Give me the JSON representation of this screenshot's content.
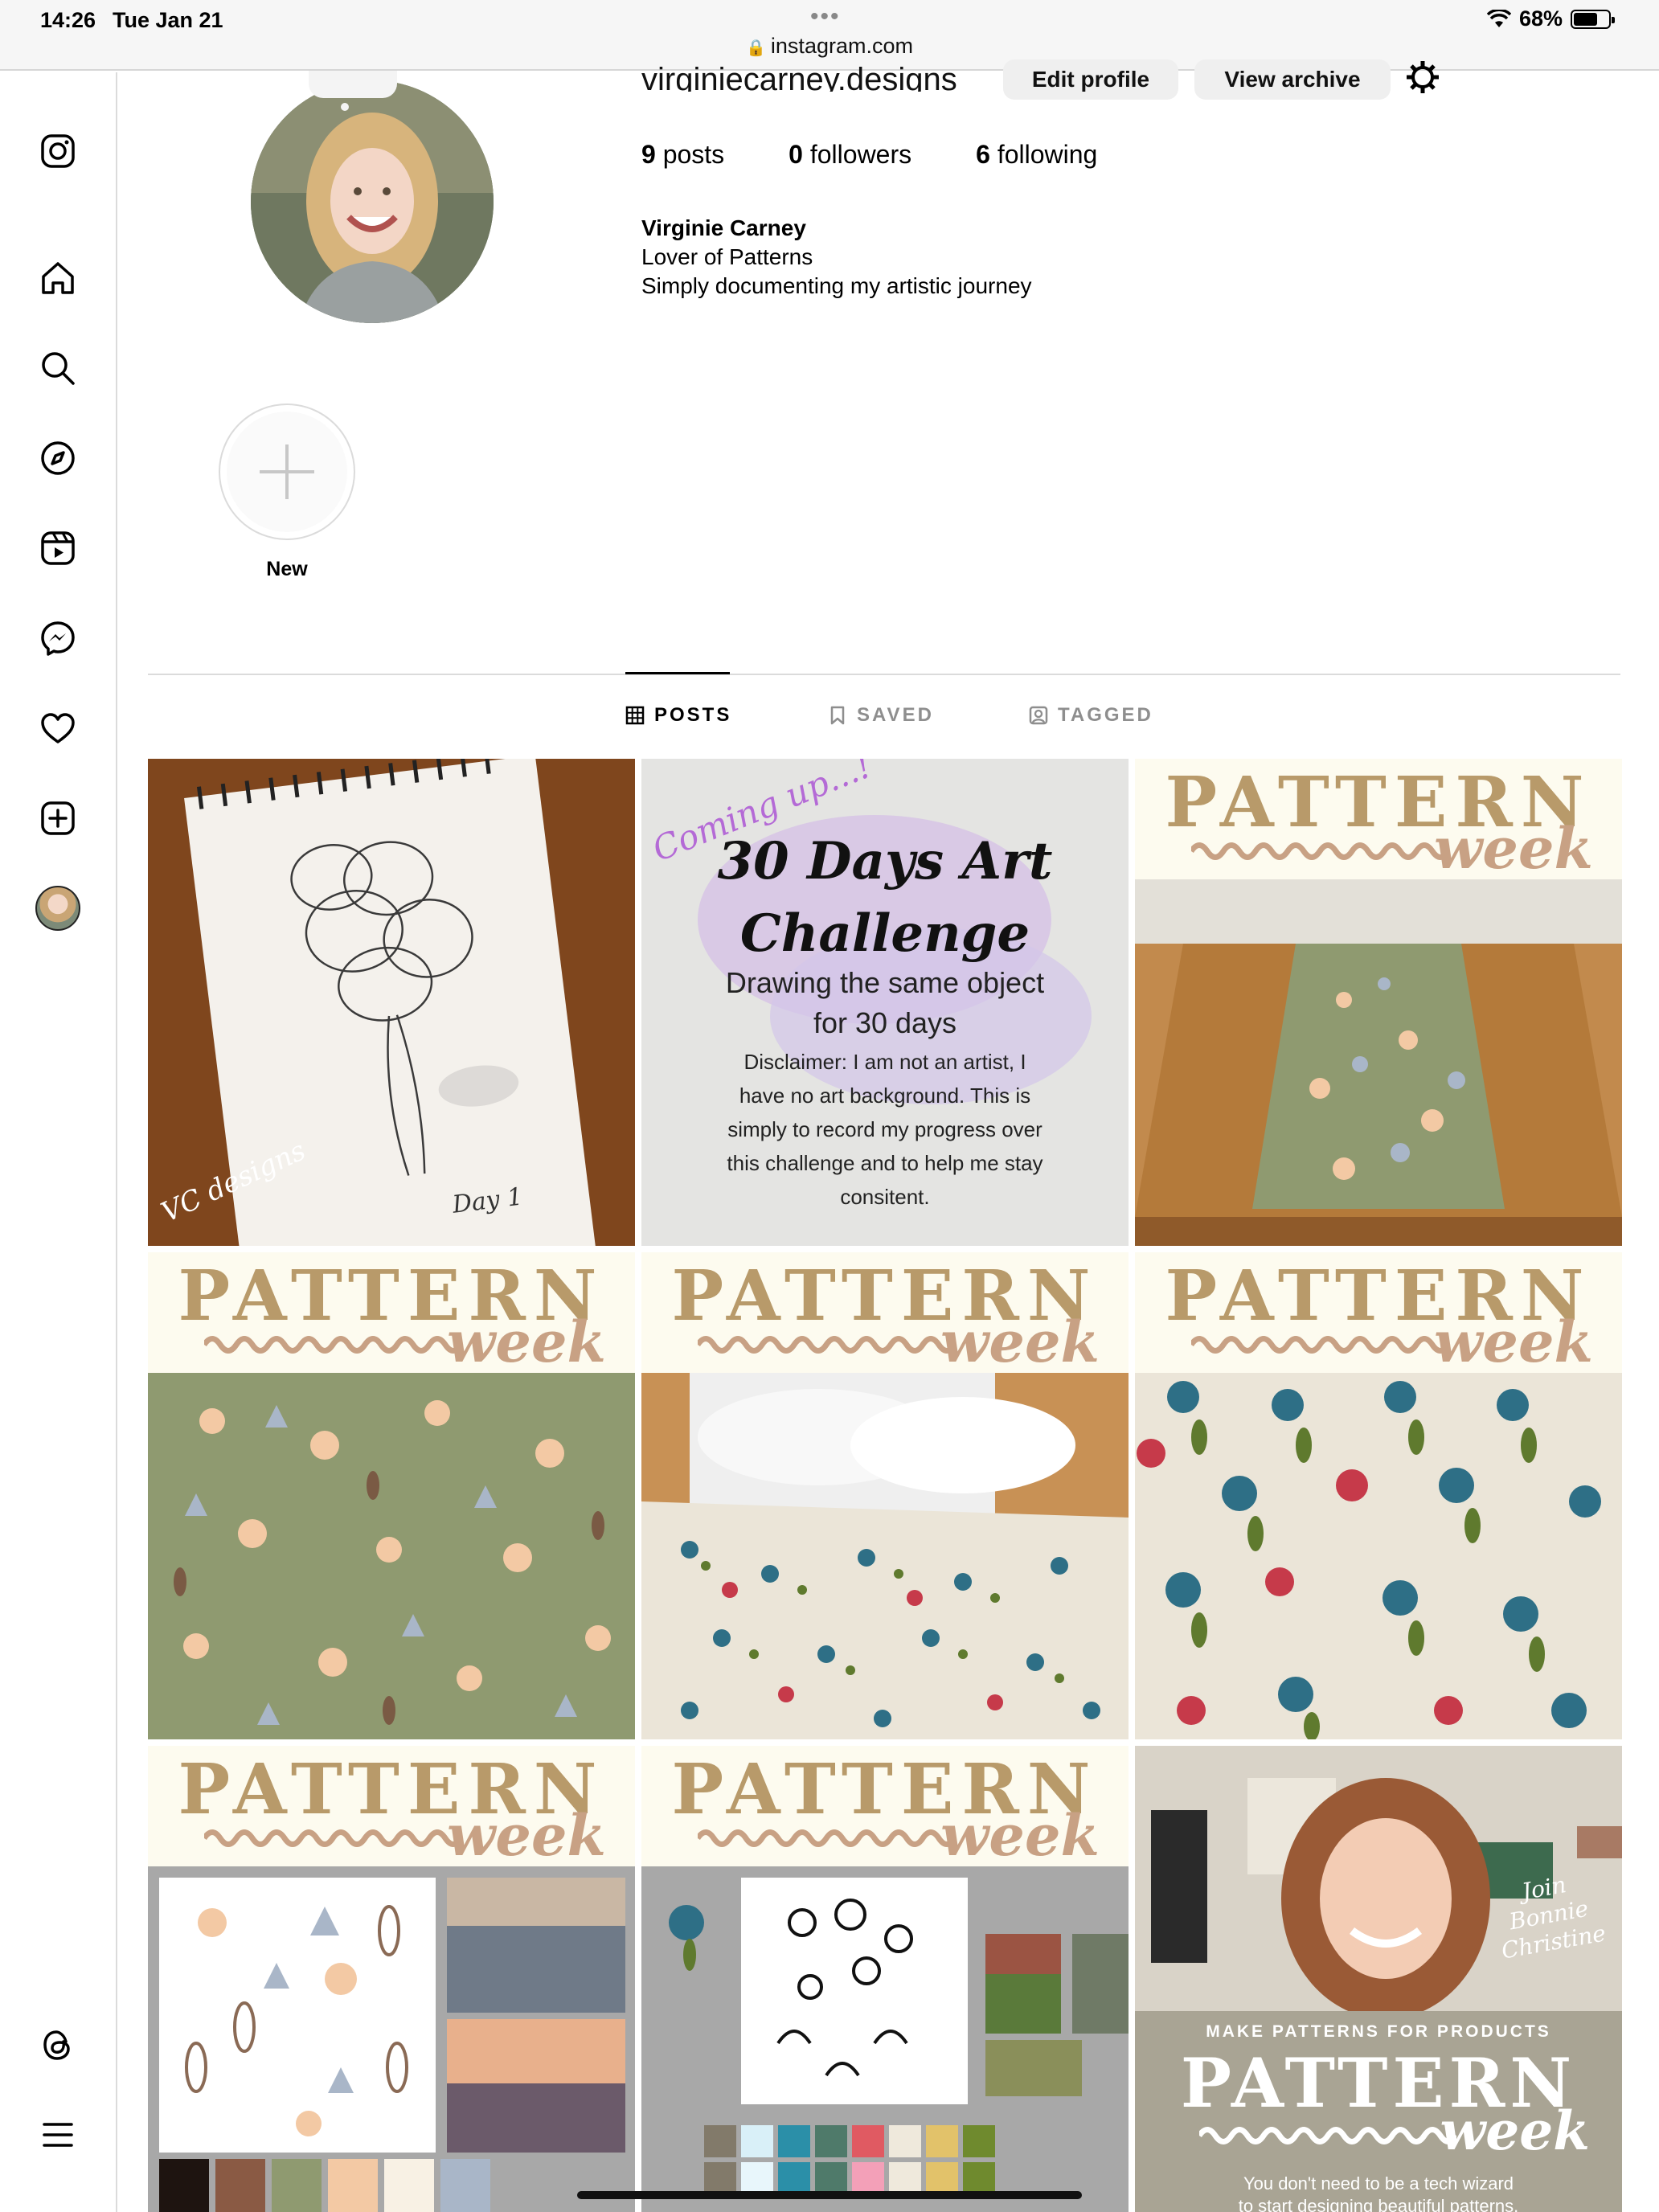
{
  "status_bar": {
    "time": "14:26",
    "date": "Tue Jan 21",
    "dots": "•••",
    "url": "instagram.com",
    "battery": "68%",
    "battery_level": 0.68
  },
  "sidebar": {
    "items": [
      {
        "icon": "instagram-logo-icon"
      },
      {
        "icon": "home-icon"
      },
      {
        "icon": "search-icon"
      },
      {
        "icon": "explore-compass-icon"
      },
      {
        "icon": "reels-icon"
      },
      {
        "icon": "messenger-icon"
      },
      {
        "icon": "heart-icon"
      },
      {
        "icon": "create-plus-icon"
      },
      {
        "icon": "profile-avatar"
      },
      {
        "icon": "threads-icon"
      },
      {
        "icon": "menu-icon"
      }
    ]
  },
  "profile": {
    "username": "virginiecarney.designs",
    "edit_button": "Edit profile",
    "archive_button": "View archive",
    "stats": {
      "posts_count": "9",
      "posts_label": "posts",
      "followers_count": "0",
      "followers_label": "followers",
      "following_count": "6",
      "following_label": "following"
    },
    "bio": {
      "name": "Virginie Carney",
      "line1": "Lover of Patterns",
      "line2": "Simply documenting my artistic journey"
    }
  },
  "highlights": {
    "new_label": "New"
  },
  "tabs": [
    {
      "label": "POSTS",
      "icon": "grid-icon",
      "active": true
    },
    {
      "label": "SAVED",
      "icon": "bookmark-icon",
      "active": false
    },
    {
      "label": "TAGGED",
      "icon": "tagged-user-icon",
      "active": false
    }
  ],
  "posts": {
    "p1": {
      "signature": "VC designs",
      "caption": "Day 1"
    },
    "p2": {
      "coming": "Coming up...!",
      "title1": "30 Days Art",
      "title2": "Challenge",
      "sub1": "Drawing the same object",
      "sub2": "for 30 days",
      "disc1": "Disclaimer: I am not an artist, I",
      "disc2": "have no art background. This is",
      "disc3": "simply to record my progress over",
      "disc4": "this challenge and to help me stay",
      "disc5": "consitent."
    },
    "pattern_title": "PATTERN",
    "pattern_week": "week",
    "p9": {
      "join1": "Join",
      "join2": "Bonnie",
      "join3": "Christine",
      "make": "MAKE PATTERNS FOR PRODUCTS",
      "title": "PATTERN",
      "week": "week",
      "tag1": "You don't need to be a tech wizard",
      "tag2": "to start designing beautiful patterns."
    }
  },
  "colors": {
    "sage": "#8f9a70",
    "cream": "#ebe5d8",
    "teal": "#2e6f86",
    "red": "#c63a4a",
    "leaf": "#5f7a2e"
  }
}
